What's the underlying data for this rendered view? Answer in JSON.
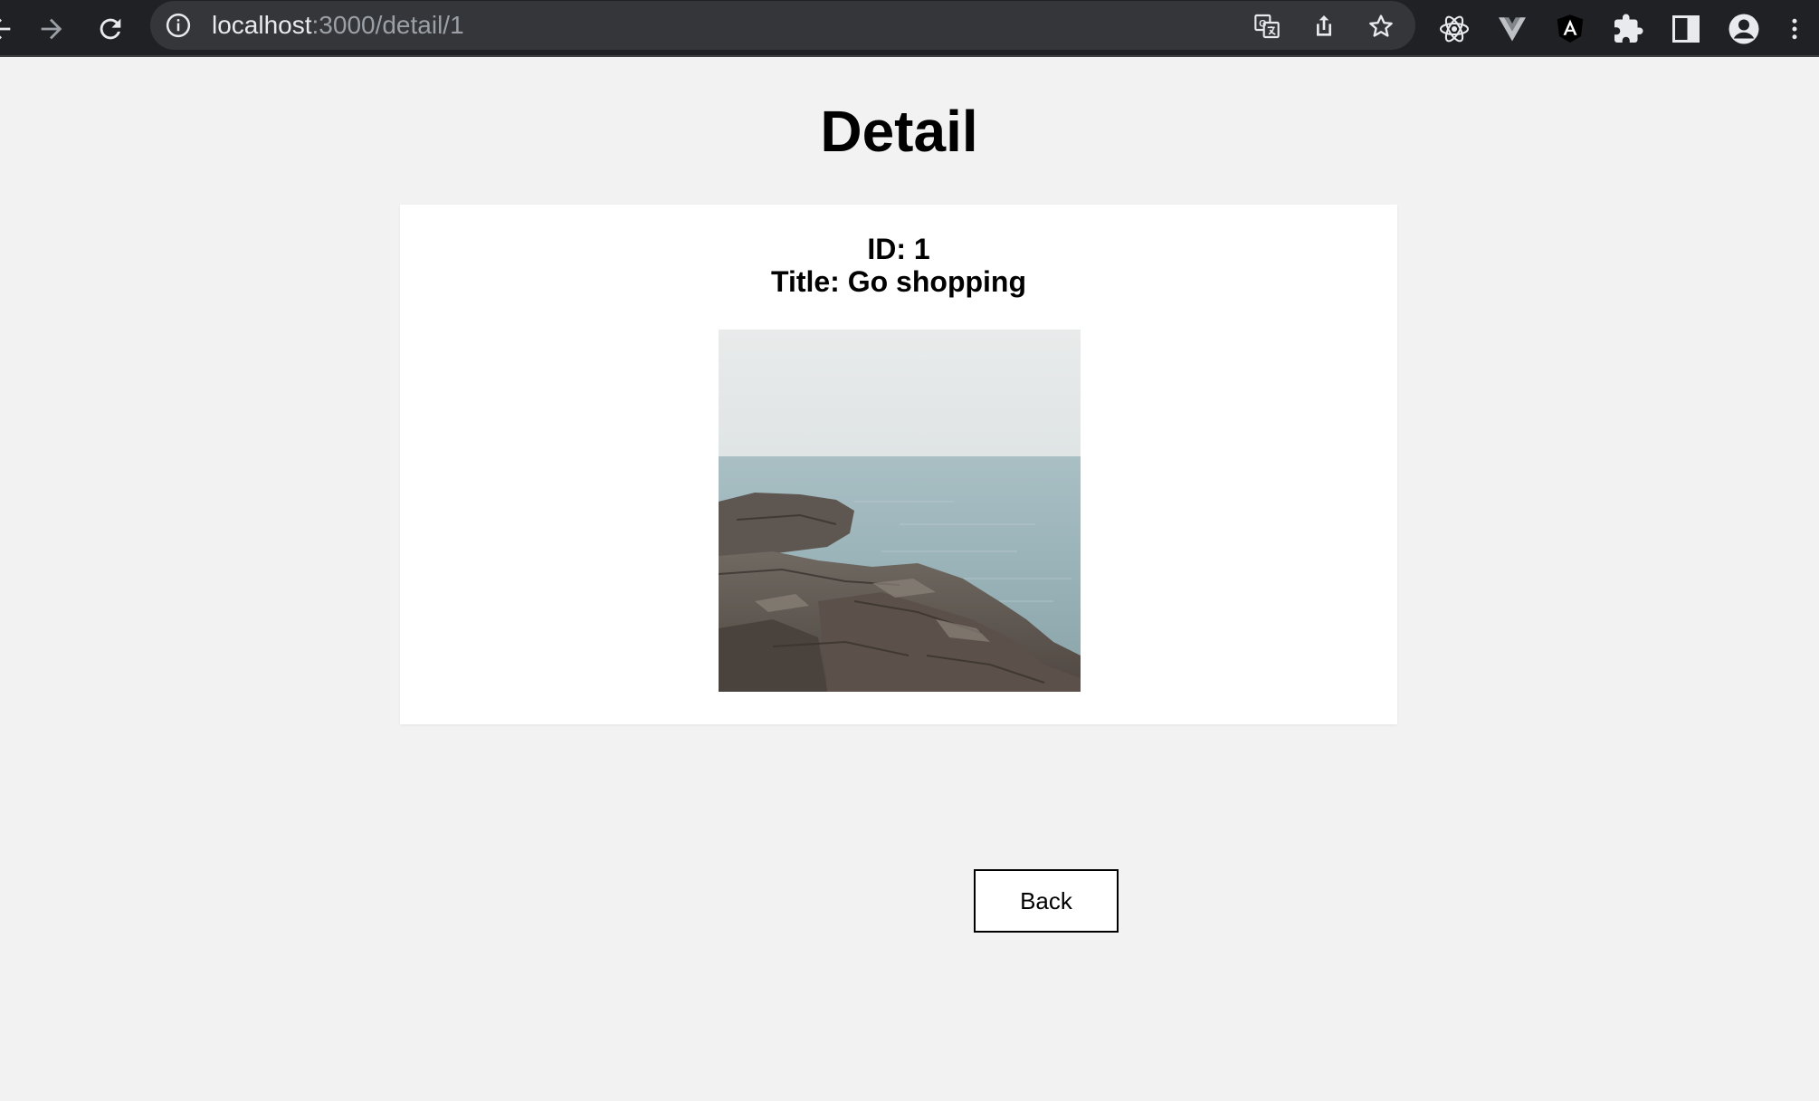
{
  "browser": {
    "url_host": "localhost",
    "url_path": ":3000/detail/1",
    "icons": {
      "back": "arrow-left-icon",
      "forward": "arrow-right-icon",
      "reload": "reload-icon",
      "site_info": "info-icon",
      "translate": "translate-icon",
      "share": "share-icon",
      "bookmark": "star-icon",
      "react_devtools": "react-icon",
      "vue_devtools": "vue-icon",
      "angular_devtools": "angular-icon",
      "extensions": "puzzle-icon",
      "side_panel": "side-panel-icon",
      "profile": "profile-icon",
      "menu": "more-vert-icon"
    }
  },
  "page": {
    "heading": "Detail",
    "detail": {
      "id_text": "ID: 1",
      "title_text": "Title: Go shopping",
      "image_alt": "rocky-shore-photo"
    },
    "back_label": "Back"
  },
  "colors": {
    "toolbar_bg": "#202124",
    "omnibox_bg": "#35363a",
    "page_bg": "#f2f2f2",
    "card_bg": "#ffffff"
  }
}
